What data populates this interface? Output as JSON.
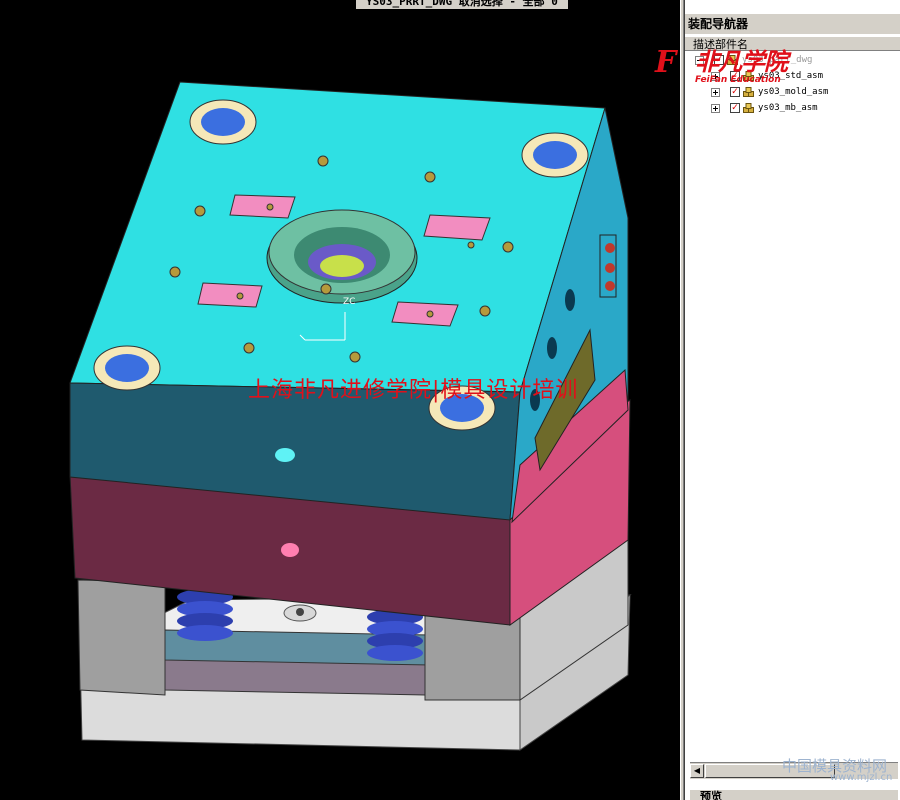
{
  "window": {
    "title": "YS03_PRRT_DWG  取消选择 - 全部 0"
  },
  "viewport": {
    "watermark_text": "上海非凡进修学院|模具设计培训",
    "axis_label": "ZC"
  },
  "navigator": {
    "title": "装配导航器",
    "column_header": "描述部件名",
    "tree": [
      {
        "label": "ys03_part_dwg",
        "checked": true,
        "expanded": true,
        "root": true
      },
      {
        "label": "ys03_std_asm",
        "checked": true,
        "expanded": false,
        "root": false
      },
      {
        "label": "ys03_mold_asm",
        "checked": true,
        "expanded": false,
        "root": false
      },
      {
        "label": "ys03_mb_asm",
        "checked": true,
        "expanded": false,
        "root": false
      }
    ],
    "preview_tab": "预览"
  },
  "logo": {
    "mark": "F",
    "main_text": "非凡学院",
    "sub_text": "FeiFan Education"
  },
  "site_watermark": {
    "text": "中国模具资料网",
    "url": "www.mjzl.cn"
  },
  "colors": {
    "plate_top": "#2fd9dc",
    "plate_front": "#1f5a6e",
    "plate_side_pink": "#d94f7d",
    "bolt_blue": "#3b6fe0",
    "accent_red": "#e0101a"
  }
}
